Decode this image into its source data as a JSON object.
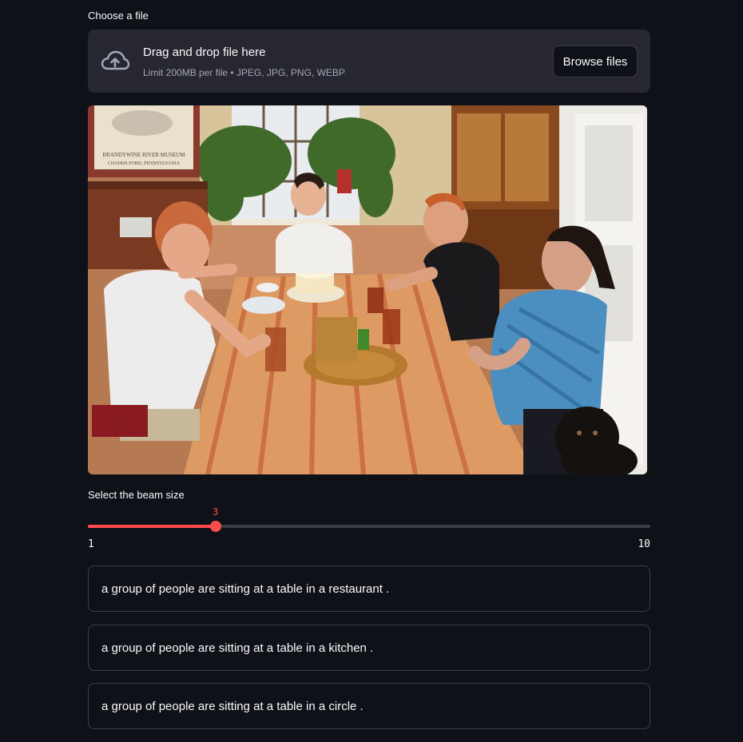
{
  "uploader": {
    "label": "Choose a file",
    "dropzone_title": "Drag and drop file here",
    "dropzone_limit": "Limit 200MB per file • JPEG, JPG, PNG, WEBP",
    "browse_label": "Browse files",
    "icon": "cloud-upload-icon"
  },
  "image": {
    "poster_line1": "BRANDYWINE RIVER MUSEUM",
    "poster_line2": "CHADDS FORD, PENNSYLVANIA"
  },
  "slider": {
    "label": "Select the beam size",
    "min": "1",
    "max": "10",
    "value": "3",
    "value_num": 3,
    "min_num": 1,
    "max_num": 10,
    "accent": "#ff4b4b"
  },
  "captions": [
    "a group of people are sitting at a table in a restaurant .",
    "a group of people are sitting at a table in a kitchen .",
    "a group of people are sitting at a table in a circle ."
  ]
}
